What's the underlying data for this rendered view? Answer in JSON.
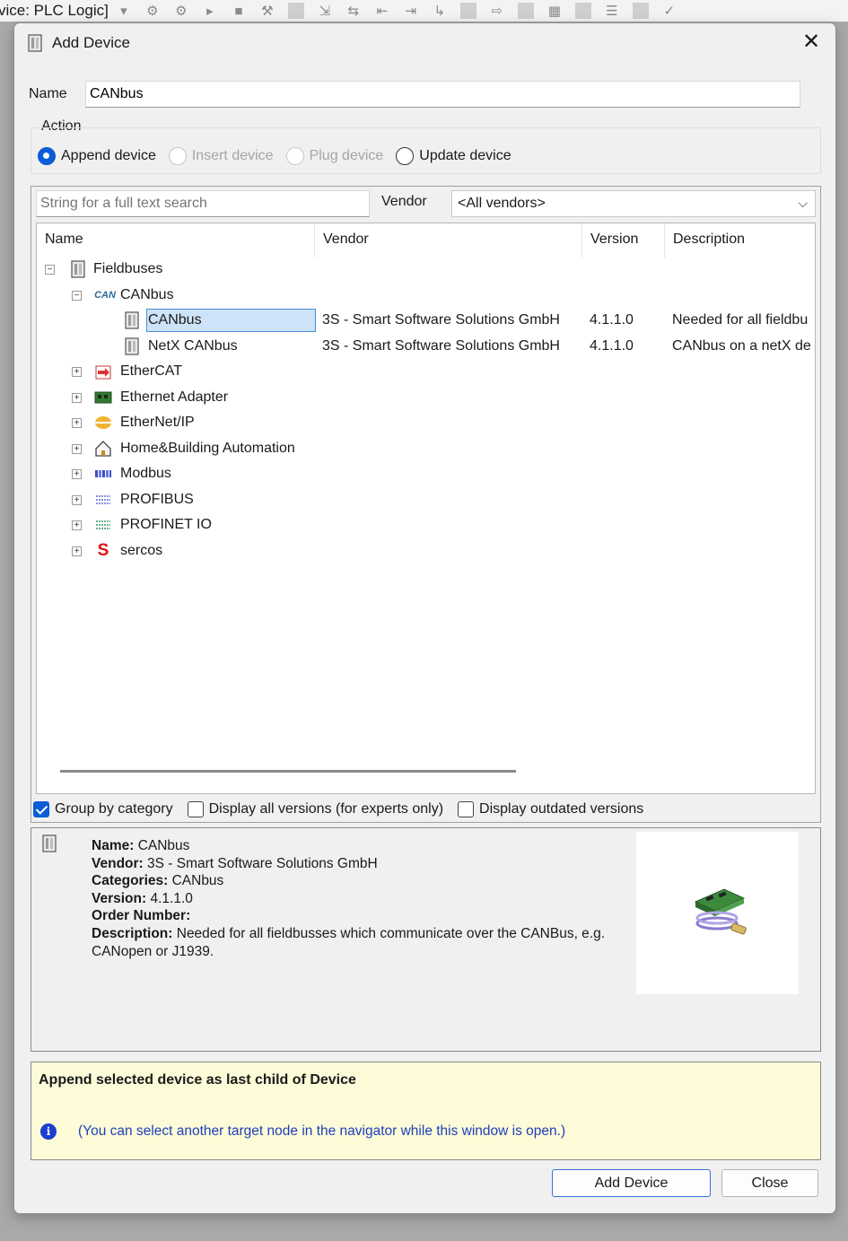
{
  "app": {
    "title": "vice: PLC Logic]"
  },
  "dialog": {
    "title": "Add Device",
    "close_glyph": "✕"
  },
  "name_field": {
    "label": "Name",
    "value": "CANbus"
  },
  "action": {
    "label": "Action",
    "options": [
      {
        "label": "Append device",
        "selected": true,
        "enabled": true
      },
      {
        "label": "Insert device",
        "selected": false,
        "enabled": false
      },
      {
        "label": "Plug device",
        "selected": false,
        "enabled": false
      },
      {
        "label": "Update device",
        "selected": false,
        "enabled": true
      }
    ]
  },
  "search": {
    "placeholder": "String for a full text search",
    "vendor_label": "Vendor",
    "vendor_selected": "<All vendors>"
  },
  "tree": {
    "columns": [
      "Name",
      "Vendor",
      "Version",
      "Description"
    ],
    "rows": [
      {
        "label": "Fieldbuses",
        "icon": "device-module-icon",
        "expander": "−",
        "vendor": "",
        "version": "",
        "description": ""
      },
      {
        "label": "CANbus",
        "icon": "can-icon",
        "icon_text": "CAN",
        "expander": "−",
        "vendor": "",
        "version": "",
        "description": ""
      },
      {
        "label": "CANbus",
        "icon": "device-module-icon",
        "expander": "",
        "vendor": "3S - Smart Software Solutions GmbH",
        "version": "4.1.1.0",
        "description": "Needed for all fieldbu",
        "selected": true
      },
      {
        "label": "NetX CANbus",
        "icon": "device-module-icon",
        "expander": "",
        "vendor": "3S - Smart Software Solutions GmbH",
        "version": "4.1.1.0",
        "description": "CANbus on a netX de"
      },
      {
        "label": "EtherCAT",
        "icon": "ethercat-icon",
        "expander": "+",
        "vendor": "",
        "version": "",
        "description": ""
      },
      {
        "label": "Ethernet Adapter",
        "icon": "ethernet-adapter-icon",
        "expander": "+",
        "vendor": "",
        "version": "",
        "description": ""
      },
      {
        "label": "EtherNet/IP",
        "icon": "ethernet-ip-icon",
        "expander": "+",
        "vendor": "",
        "version": "",
        "description": ""
      },
      {
        "label": "Home&Building Automation",
        "icon": "house-icon",
        "expander": "+",
        "vendor": "",
        "version": "",
        "description": ""
      },
      {
        "label": "Modbus",
        "icon": "modbus-icon",
        "expander": "+",
        "vendor": "",
        "version": "",
        "description": ""
      },
      {
        "label": "PROFIBUS",
        "icon": "profibus-icon",
        "expander": "+",
        "vendor": "",
        "version": "",
        "description": ""
      },
      {
        "label": "PROFINET IO",
        "icon": "profinet-icon",
        "expander": "+",
        "vendor": "",
        "version": "",
        "description": ""
      },
      {
        "label": "sercos",
        "icon": "sercos-icon",
        "icon_text": "S",
        "expander": "+",
        "vendor": "",
        "version": "",
        "description": ""
      }
    ]
  },
  "options": {
    "group_by_category": {
      "label": "Group by category",
      "checked": true
    },
    "display_all_versions": {
      "label": "Display all versions (for experts only)",
      "checked": false
    },
    "display_outdated": {
      "label": "Display outdated versions",
      "checked": false
    }
  },
  "info": {
    "name_key": "Name:",
    "name_val": " CANbus",
    "vendor_key": "Vendor:",
    "vendor_val": " 3S - Smart Software Solutions GmbH",
    "categories_key": "Categories:",
    "categories_val": " CANbus",
    "version_key": "Version:",
    "version_val": " 4.1.1.0",
    "order_key": "Order Number:",
    "order_val": "",
    "description_key": "Description:",
    "description_val": " Needed for all fieldbusses which communicate over the CANBus, e.g. CANopen or J1939."
  },
  "hint": {
    "title": "Append selected device as last child of Device",
    "note": "(You can select another target node in the navigator while this window is open.)"
  },
  "buttons": {
    "add_device": "Add Device",
    "close": "Close"
  },
  "colors": {
    "accent": "#0b5cd6",
    "selection": "#cde3f8",
    "hint_bg": "#fdfbd8",
    "hint_text": "#1f3fb8"
  }
}
